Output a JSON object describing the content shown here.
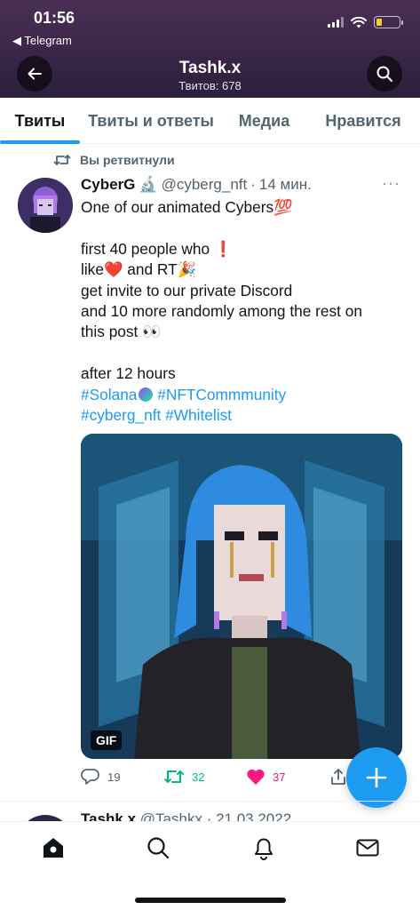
{
  "status_bar": {
    "time": "01:56",
    "back_app": "◀ Telegram",
    "battery_percent": 25
  },
  "header": {
    "title": "Tashk.x",
    "subtitle": "Твитов: 678"
  },
  "tabs": [
    {
      "label": "Твиты",
      "active": true
    },
    {
      "label": "Твиты и ответы",
      "active": false
    },
    {
      "label": "Медиа",
      "active": false
    },
    {
      "label": "Нравится",
      "active": false
    }
  ],
  "tweet": {
    "retweet_label": "Вы ретвитнули",
    "name": "CyberG",
    "name_emoji": "🔬",
    "handle": "@cyberg_nft",
    "separator": "·",
    "time": "14 мин.",
    "more": "···",
    "lines": {
      "l1": "One of our animated Cybers",
      "l1_emoji": "💯",
      "l3": "first 40 people who ",
      "l3_emoji": "❗",
      "l4a": "like",
      "l4_heart": "❤️",
      "l4b": " and RT",
      "l4_party": "🎉",
      "l5": "get invite to our private Discord",
      "l6": "and 10 more randomly among the rest on",
      "l7": "this post ",
      "l7_emoji": "👀",
      "l9": "after 12 hours",
      "h1": "#Solana",
      "h2": " #NFTCommmunity",
      "h3": "#cyberg_nft",
      "h4": " #Whitelist"
    },
    "media_badge": "GIF",
    "stats": {
      "replies": "19",
      "retweets": "32",
      "likes": "37"
    }
  },
  "next_tweet": {
    "name": "Tashk.x",
    "handle": "@Tashkx",
    "date": "· 21.03.2022"
  },
  "colors": {
    "accent": "#1d9bf0",
    "retweet": "#00ba7c",
    "like": "#f91880",
    "header_bg": "#3b2748"
  }
}
